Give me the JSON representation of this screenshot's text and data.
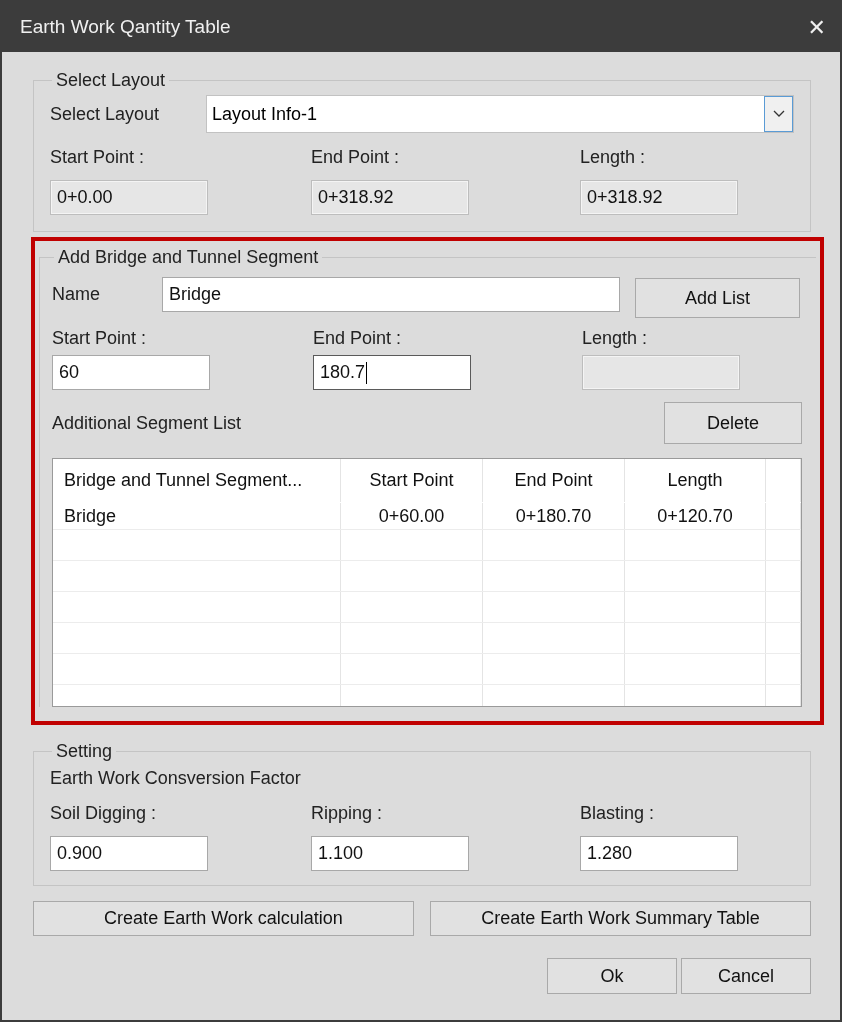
{
  "window": {
    "title": "Earth Work Qantity Table",
    "close": "✕"
  },
  "layout_group": {
    "title": "Select Layout",
    "select_label": "Select Layout",
    "select_value": "Layout Info-1",
    "fields": [
      {
        "label": "Start Point :",
        "value": "0+0.00",
        "disabled": true
      },
      {
        "label": "End Point :",
        "value": "0+318.92",
        "disabled": true
      },
      {
        "label": "Length :",
        "value": "0+318.92",
        "disabled": true
      }
    ]
  },
  "segment_group": {
    "title": "Add Bridge and Tunnel Segment",
    "highlighted": true,
    "name_label": "Name",
    "name_value": "Bridge",
    "add_button": "Add List",
    "fields": [
      {
        "label": "Start Point :",
        "value": "60",
        "disabled": false,
        "focused": false
      },
      {
        "label": "End Point :",
        "value": "180.7",
        "disabled": false,
        "focused": true
      },
      {
        "label": "Length :",
        "disabled": true,
        "focused": false
      }
    ],
    "list_label": "Additional Segment List",
    "delete_button": "Delete",
    "table": {
      "columns": [
        "Bridge and Tunnel Segment...",
        "Start Point",
        "End Point",
        "Length"
      ],
      "rows": [
        [
          "Bridge",
          "0+60.00",
          "0+180.70",
          "0+120.70"
        ]
      ]
    }
  },
  "setting_group": {
    "title": "Setting",
    "subtitle": "Earth Work Consversion Factor",
    "fields": [
      {
        "label": "Soil Digging :",
        "value": "0.900",
        "disabled": false
      },
      {
        "label": "Ripping :",
        "value": "1.100",
        "disabled": false
      },
      {
        "label": "Blasting :",
        "value": "1.280",
        "disabled": false
      }
    ]
  },
  "action_buttons": [
    "Create Earth Work calculation",
    "Create Earth Work Summary Table"
  ],
  "dialog_buttons": [
    "Ok",
    "Cancel"
  ]
}
